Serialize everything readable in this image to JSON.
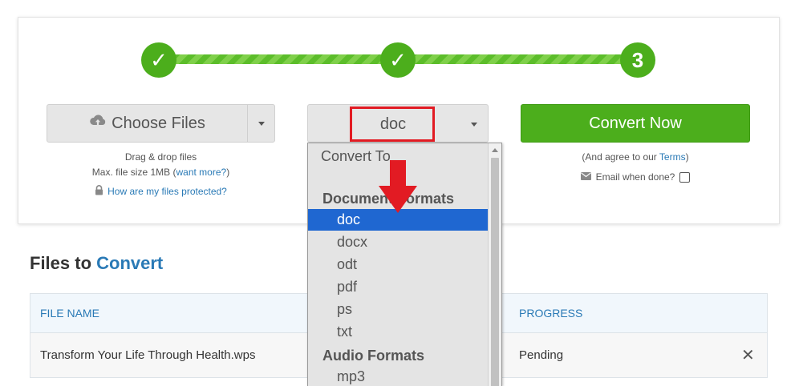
{
  "stepper": {
    "step1": "✓",
    "step2": "✓",
    "step3": "3"
  },
  "choose_files": {
    "label": "Choose Files",
    "icon": "cloud-upload-icon"
  },
  "upload_help": {
    "drag_drop": "Drag & drop files",
    "max_size": "Max. file size 1MB (",
    "want_more": "want more?",
    "max_size_end": ")",
    "protected_link": "How are my files protected?",
    "lock_icon": "lock-icon"
  },
  "format_select": {
    "value": "doc"
  },
  "convert": {
    "button_label": "Convert Now",
    "agree_prefix": "(And agree to our ",
    "terms": "Terms",
    "agree_suffix": ")",
    "email_label": "Email when done?",
    "email_checked": false
  },
  "dropdown": {
    "placeholder": "Convert To",
    "groups": [
      {
        "label": "Document Formats",
        "items": [
          "doc",
          "docx",
          "odt",
          "pdf",
          "ps",
          "txt"
        ]
      },
      {
        "label": "Audio Formats",
        "items": [
          "mp3"
        ]
      }
    ],
    "selected": "doc"
  },
  "files_section": {
    "title_prefix": "Files to ",
    "title_accent": "Convert",
    "columns": [
      "FILE NAME",
      "PROGRESS"
    ],
    "rows": [
      {
        "file_name": "Transform Your Life Through Health.wps",
        "progress": "Pending"
      }
    ],
    "remove_glyph": "✕"
  },
  "colors": {
    "accent_green": "#4cae1c",
    "link_blue": "#2a7ab6",
    "selection_blue": "#1f67d1",
    "annotation_red": "#e21b23"
  }
}
